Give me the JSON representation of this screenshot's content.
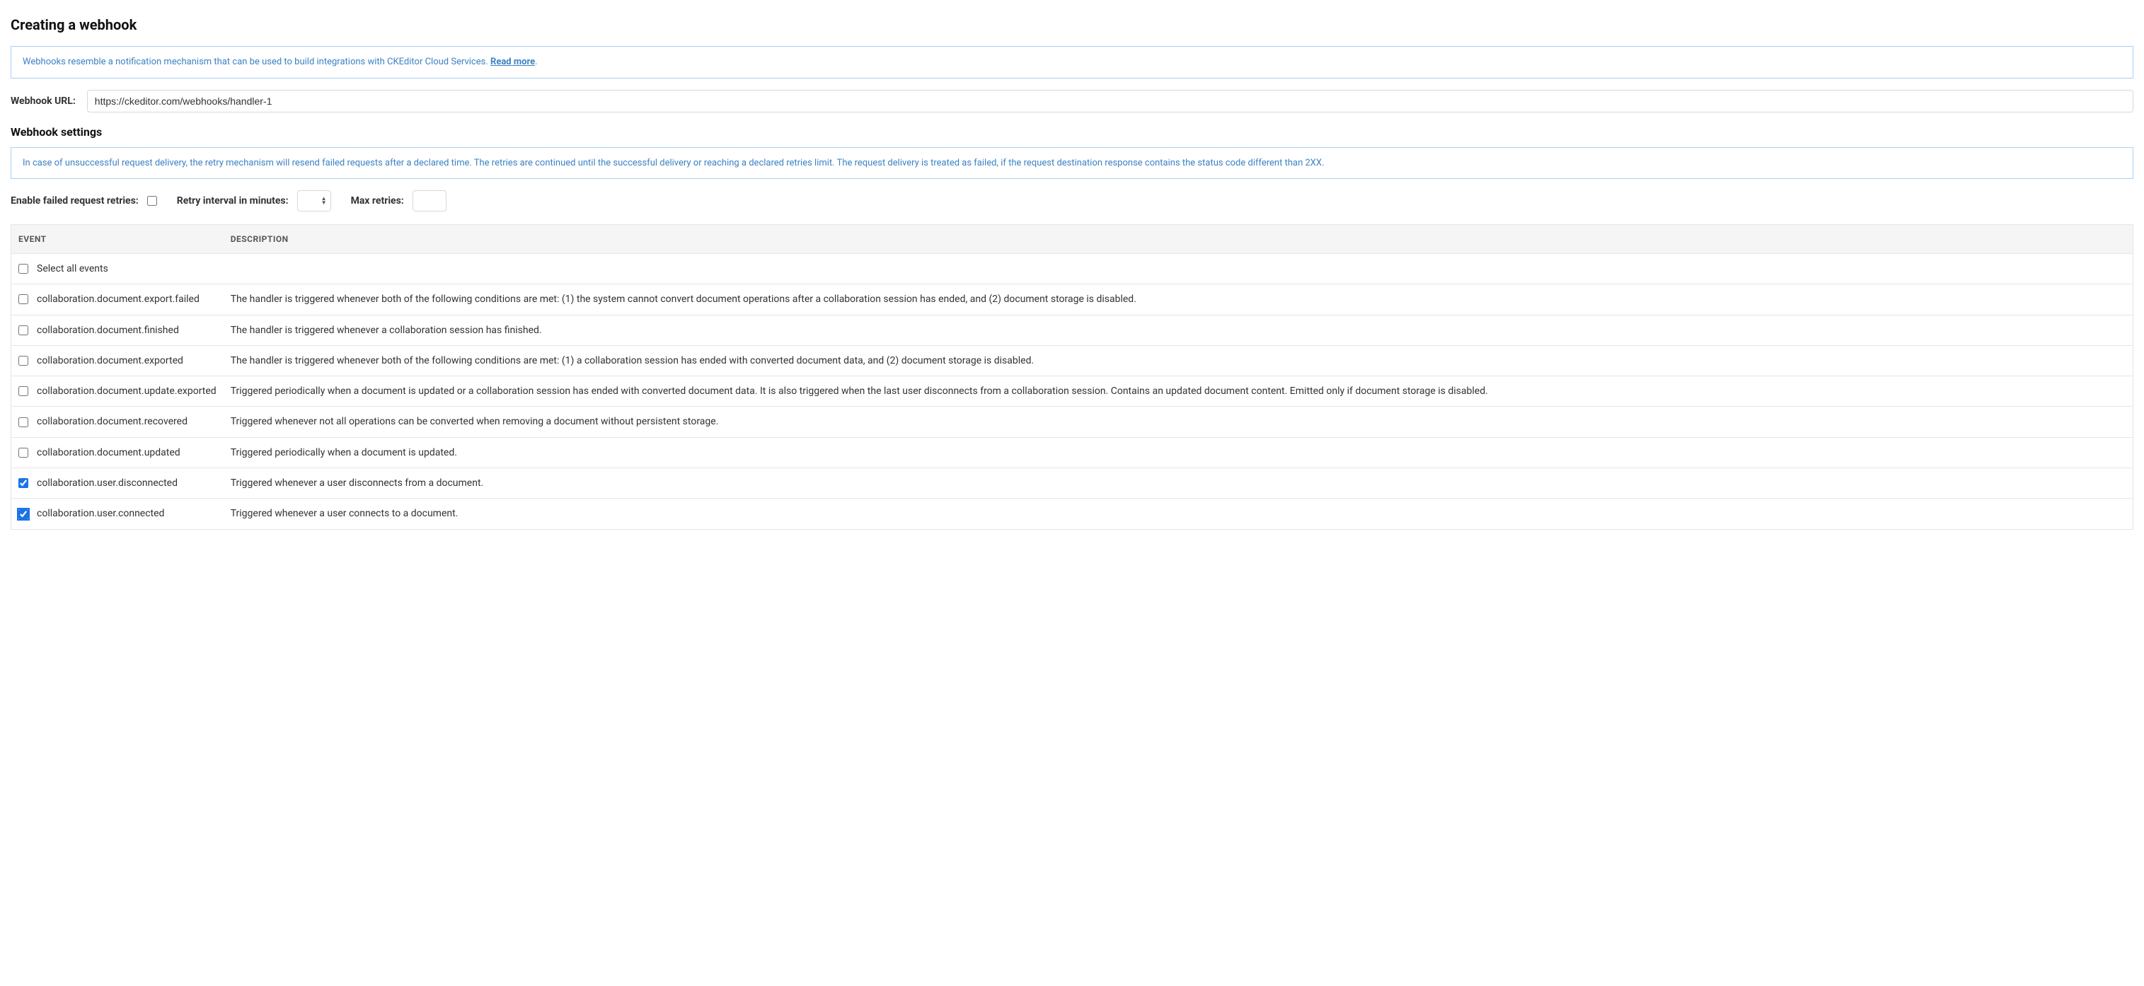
{
  "page": {
    "title": "Creating a webhook"
  },
  "infoBox1": {
    "text": "Webhooks resemble a notification mechanism that can be used to build integrations with CKEditor Cloud Services. ",
    "linkText": "Read more",
    "suffix": "."
  },
  "webhookUrl": {
    "label": "Webhook URL:",
    "value": "https://ckeditor.com/webhooks/handler-1"
  },
  "settingsHeading": "Webhook settings",
  "infoBox2": {
    "text": "In case of unsuccessful request delivery, the retry mechanism will resend failed requests after a declared time. The retries are continued until the successful delivery or reaching a declared retries limit. The request delivery is treated as failed, if the request destination response contains the status code different than 2XX."
  },
  "retrySettings": {
    "enableLabel": "Enable failed request retries:",
    "enableChecked": false,
    "intervalLabel": "Retry interval in minutes:",
    "intervalValue": "",
    "maxRetriesLabel": "Max retries:",
    "maxRetriesValue": ""
  },
  "table": {
    "headers": {
      "event": "EVENT",
      "description": "DESCRIPTION"
    },
    "selectAll": {
      "label": "Select all events",
      "checked": false
    },
    "rows": [
      {
        "checked": false,
        "focused": false,
        "event": "collaboration.document.export.failed",
        "description": "The handler is triggered whenever both of the following conditions are met: (1) the system cannot convert document operations after a collaboration session has ended, and (2) document storage is disabled."
      },
      {
        "checked": false,
        "focused": false,
        "event": "collaboration.document.finished",
        "description": "The handler is triggered whenever a collaboration session has finished."
      },
      {
        "checked": false,
        "focused": false,
        "event": "collaboration.document.exported",
        "description": "The handler is triggered whenever both of the following conditions are met: (1) a collaboration session has ended with converted document data, and (2) document storage is disabled."
      },
      {
        "checked": false,
        "focused": false,
        "event": "collaboration.document.update.exported",
        "description": "Triggered periodically when a document is updated or a collaboration session has ended with converted document data. It is also triggered when the last user disconnects from a collaboration session. Contains an updated document content. Emitted only if document storage is disabled."
      },
      {
        "checked": false,
        "focused": false,
        "event": "collaboration.document.recovered",
        "description": "Triggered whenever not all operations can be converted when removing a document without persistent storage."
      },
      {
        "checked": false,
        "focused": false,
        "event": "collaboration.document.updated",
        "description": "Triggered periodically when a document is updated."
      },
      {
        "checked": true,
        "focused": false,
        "event": "collaboration.user.disconnected",
        "description": "Triggered whenever a user disconnects from a document."
      },
      {
        "checked": true,
        "focused": true,
        "event": "collaboration.user.connected",
        "description": "Triggered whenever a user connects to a document."
      }
    ]
  }
}
